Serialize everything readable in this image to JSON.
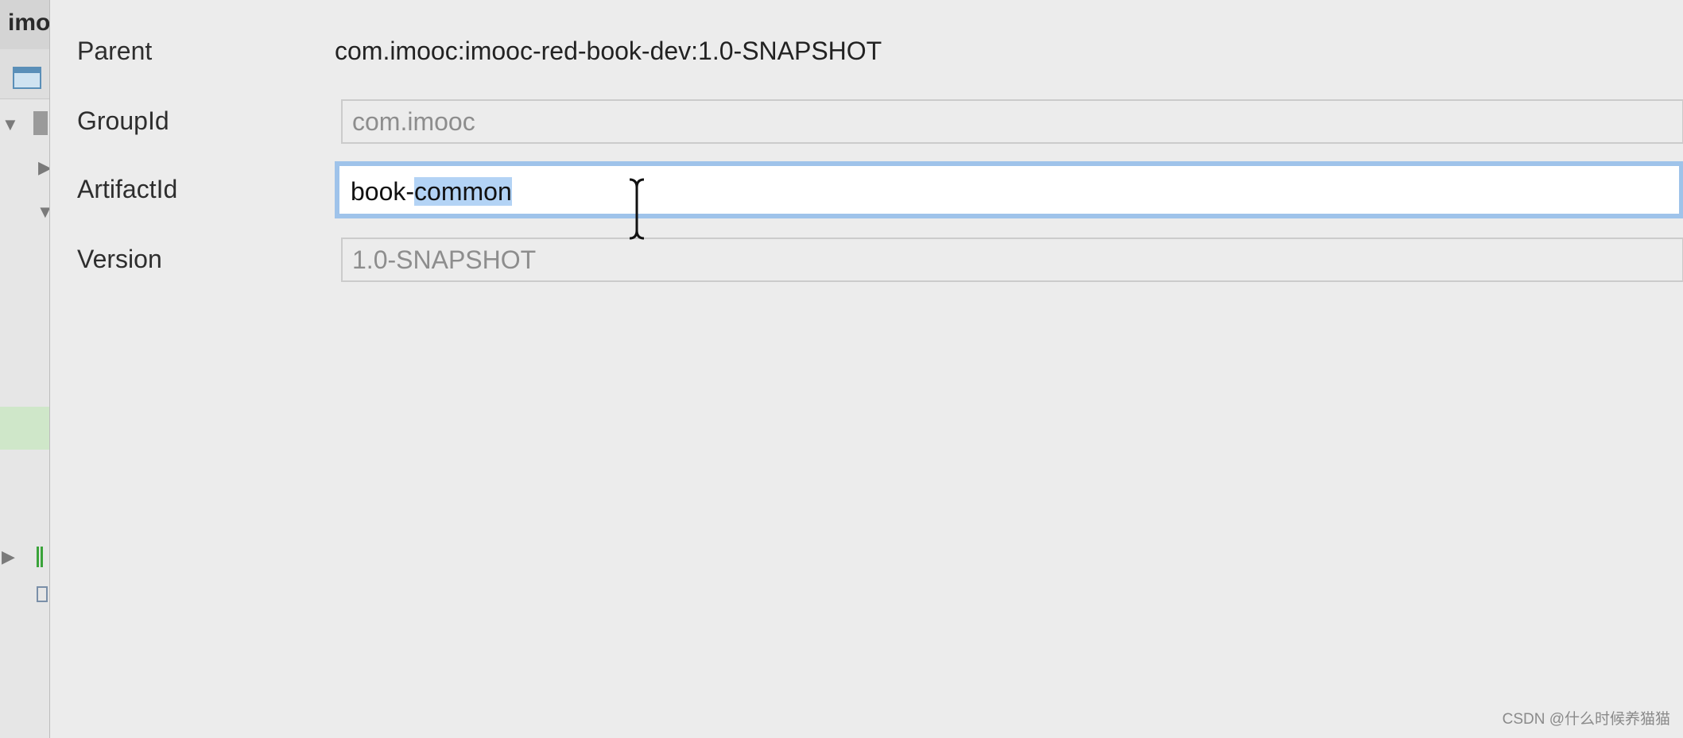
{
  "ide": {
    "project_title": "imo"
  },
  "form": {
    "parent": {
      "label": "Parent",
      "value": "com.imooc:imooc-red-book-dev:1.0-SNAPSHOT"
    },
    "group_id": {
      "label": "GroupId",
      "value": "com.imooc"
    },
    "artifact_id": {
      "label": "ArtifactId",
      "value_prefix": "book-",
      "value_selected": "common"
    },
    "version": {
      "label": "Version",
      "value": "1.0-SNAPSHOT"
    }
  },
  "watermark": "CSDN @什么时候养猫猫",
  "colors": {
    "focus_border": "#9fc3ea",
    "selection": "#b3d3f5",
    "background": "#ececec"
  },
  "icons": [
    "window-icon",
    "expand-arrow-icon",
    "collapse-arrow-icon",
    "folder-icon",
    "text-cursor-icon"
  ]
}
